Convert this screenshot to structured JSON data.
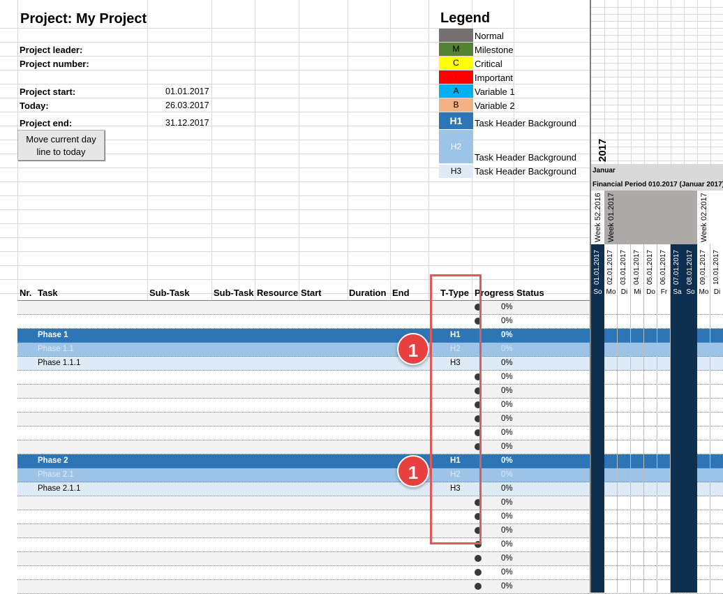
{
  "header": {
    "title": "Project: My Project",
    "leader_label": "Project leader:",
    "number_label": "Project number:",
    "start_label": "Project start:",
    "start_value": "01.01.2017",
    "today_label": "Today:",
    "today_value": "26.03.2017",
    "end_label": "Project end:",
    "end_value": "31.12.2017",
    "button_label": "Move current day line to today"
  },
  "legend": {
    "title": "Legend",
    "items": [
      {
        "code": "",
        "label": "Normal",
        "color": "#767171"
      },
      {
        "code": "M",
        "label": "Milestone",
        "color": "#548235"
      },
      {
        "code": "C",
        "label": "Critical",
        "color": "#ffff00"
      },
      {
        "code": "I",
        "label": "Important",
        "color": "#ff0000"
      },
      {
        "code": "A",
        "label": "Variable 1",
        "color": "#00b0f0"
      },
      {
        "code": "B",
        "label": "Variable 2",
        "color": "#f4b183"
      },
      {
        "code": "H1",
        "label": "Task Header Background",
        "color": "#2e75b6"
      },
      {
        "code": "H2",
        "label": "Task Header Background",
        "color": "#9dc3e6"
      },
      {
        "code": "H3",
        "label": "Task Header Background",
        "color": "#deebf7"
      }
    ]
  },
  "columns": [
    "Nr.",
    "Task",
    "Sub-Task",
    "Sub-Task",
    "Resource",
    "Start",
    "Duration",
    "End",
    "T-Type",
    "Progress",
    "Status"
  ],
  "rows": [
    {
      "task": "",
      "ttype": "",
      "dot": true,
      "pct": "0%",
      "kind": "grey"
    },
    {
      "task": "",
      "ttype": "",
      "dot": true,
      "pct": "0%",
      "kind": "white"
    },
    {
      "task": "Phase 1",
      "ttype": "H1",
      "dot": false,
      "pct": "0%",
      "kind": "h1"
    },
    {
      "task": "Phase 1.1",
      "ttype": "H2",
      "dot": false,
      "pct": "0%",
      "kind": "h2"
    },
    {
      "task": "Phase 1.1.1",
      "ttype": "H3",
      "dot": false,
      "pct": "0%",
      "kind": "h3"
    },
    {
      "task": "",
      "ttype": "",
      "dot": true,
      "pct": "0%",
      "kind": "white"
    },
    {
      "task": "",
      "ttype": "",
      "dot": true,
      "pct": "0%",
      "kind": "grey"
    },
    {
      "task": "",
      "ttype": "",
      "dot": true,
      "pct": "0%",
      "kind": "white"
    },
    {
      "task": "",
      "ttype": "",
      "dot": true,
      "pct": "0%",
      "kind": "grey"
    },
    {
      "task": "",
      "ttype": "",
      "dot": true,
      "pct": "0%",
      "kind": "white"
    },
    {
      "task": "",
      "ttype": "",
      "dot": true,
      "pct": "0%",
      "kind": "grey"
    },
    {
      "task": "Phase 2",
      "ttype": "H1",
      "dot": false,
      "pct": "0%",
      "kind": "h1"
    },
    {
      "task": "Phase 2.1",
      "ttype": "H2",
      "dot": false,
      "pct": "0%",
      "kind": "h2"
    },
    {
      "task": "Phase 2.1.1",
      "ttype": "H3",
      "dot": false,
      "pct": "0%",
      "kind": "h3"
    },
    {
      "task": "",
      "ttype": "",
      "dot": true,
      "pct": "0%",
      "kind": "grey"
    },
    {
      "task": "",
      "ttype": "",
      "dot": true,
      "pct": "0%",
      "kind": "white"
    },
    {
      "task": "",
      "ttype": "",
      "dot": true,
      "pct": "0%",
      "kind": "grey"
    },
    {
      "task": "",
      "ttype": "",
      "dot": true,
      "pct": "0%",
      "kind": "white"
    },
    {
      "task": "",
      "ttype": "",
      "dot": true,
      "pct": "0%",
      "kind": "grey"
    },
    {
      "task": "",
      "ttype": "",
      "dot": true,
      "pct": "0%",
      "kind": "white"
    },
    {
      "task": "",
      "ttype": "",
      "dot": true,
      "pct": "0%",
      "kind": "grey"
    }
  ],
  "gantt": {
    "year": "2017",
    "month": "Januar",
    "period": "Financial Period 010.2017 (Januar 2017)",
    "week1": "Week 52.2016",
    "week2": "Week 01.2017",
    "week3": "Week 02.2017",
    "dates": [
      "01.01.2017",
      "02.01.2017",
      "03.01.2017",
      "04.01.2017",
      "05.01.2017",
      "06.01.2017",
      "07.01.2017",
      "08.01.2017",
      "09.01.2017",
      "10.01.2017"
    ],
    "days": [
      "So",
      "Mo",
      "Di",
      "Mi",
      "Do",
      "Fr",
      "Sa",
      "So",
      "Mo",
      "Di"
    ],
    "weekend_color": "#0e2f4f"
  },
  "annotations": {
    "badge1": "1",
    "badge2": "1"
  }
}
